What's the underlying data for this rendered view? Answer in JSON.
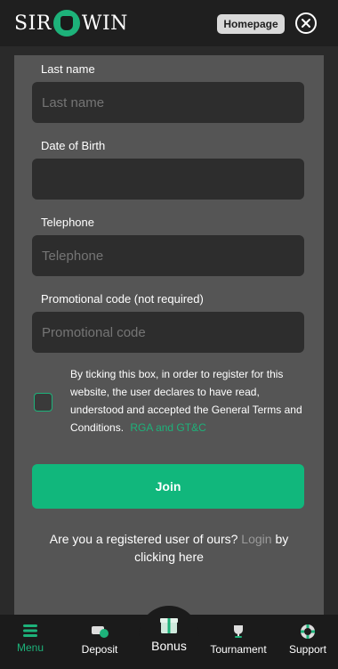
{
  "header": {
    "logo_left": "SIR",
    "logo_right": "WIN",
    "homepage_label": "Homepage"
  },
  "form": {
    "last_name": {
      "label": "Last name",
      "placeholder": "Last name"
    },
    "dob": {
      "label": "Date of Birth",
      "placeholder": ""
    },
    "telephone": {
      "label": "Telephone",
      "placeholder": "Telephone"
    },
    "promo": {
      "label": "Promotional code (not required)",
      "placeholder": "Promotional code"
    },
    "terms_text": "By ticking this box, in order to register for this website, the user declares to have read, understood and accepted the General Terms and Conditions.",
    "terms_link": "RGA and GT&C",
    "join_label": "Join",
    "login_prefix": "Are you a registered user of ours?",
    "login_link": "Login",
    "login_suffix": "by clicking here"
  },
  "nav": {
    "menu": "Menu",
    "deposit": "Deposit",
    "bonus": "Bonus",
    "tournament": "Tournament",
    "support": "Support"
  },
  "colors": {
    "accent": "#11b77c",
    "panel": "#555555",
    "input_bg": "#2d2d2d",
    "nav_bg": "#1b1b1b"
  }
}
